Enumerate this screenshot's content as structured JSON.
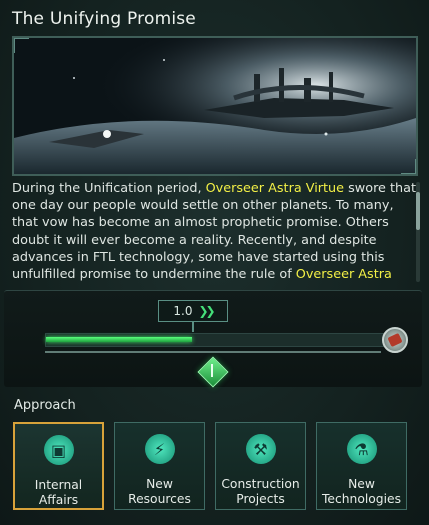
{
  "event": {
    "title": "The Unifying Promise",
    "description_parts": {
      "p1": "During the Unification period, ",
      "h1": "Overseer Astra Virtue",
      "p2": " swore that one day our people would settle on other planets. To many, that vow has become an almost prophetic promise. Others doubt it will ever become a reality. Recently, and despite advances in FTL technology, some have started using this unfulfilled promise to undermine the rule of ",
      "h2": "Overseer Astra"
    },
    "highlight_color": "#f2ef46"
  },
  "slider": {
    "value_text": "1.0",
    "progress": 0.43,
    "fill_color": "#45e07a"
  },
  "approach": {
    "label": "Approach",
    "options": [
      {
        "line1": "Internal",
        "line2": "Affairs",
        "icon": "internal-affairs-icon",
        "selected": true
      },
      {
        "line1": "New",
        "line2": "Resources",
        "icon": "resources-bolt-icon",
        "selected": false
      },
      {
        "line1": "Construction",
        "line2": "Projects",
        "icon": "construction-icon",
        "selected": false
      },
      {
        "line1": "New",
        "line2": "Technologies",
        "icon": "technology-microscope-icon",
        "selected": false
      }
    ]
  }
}
